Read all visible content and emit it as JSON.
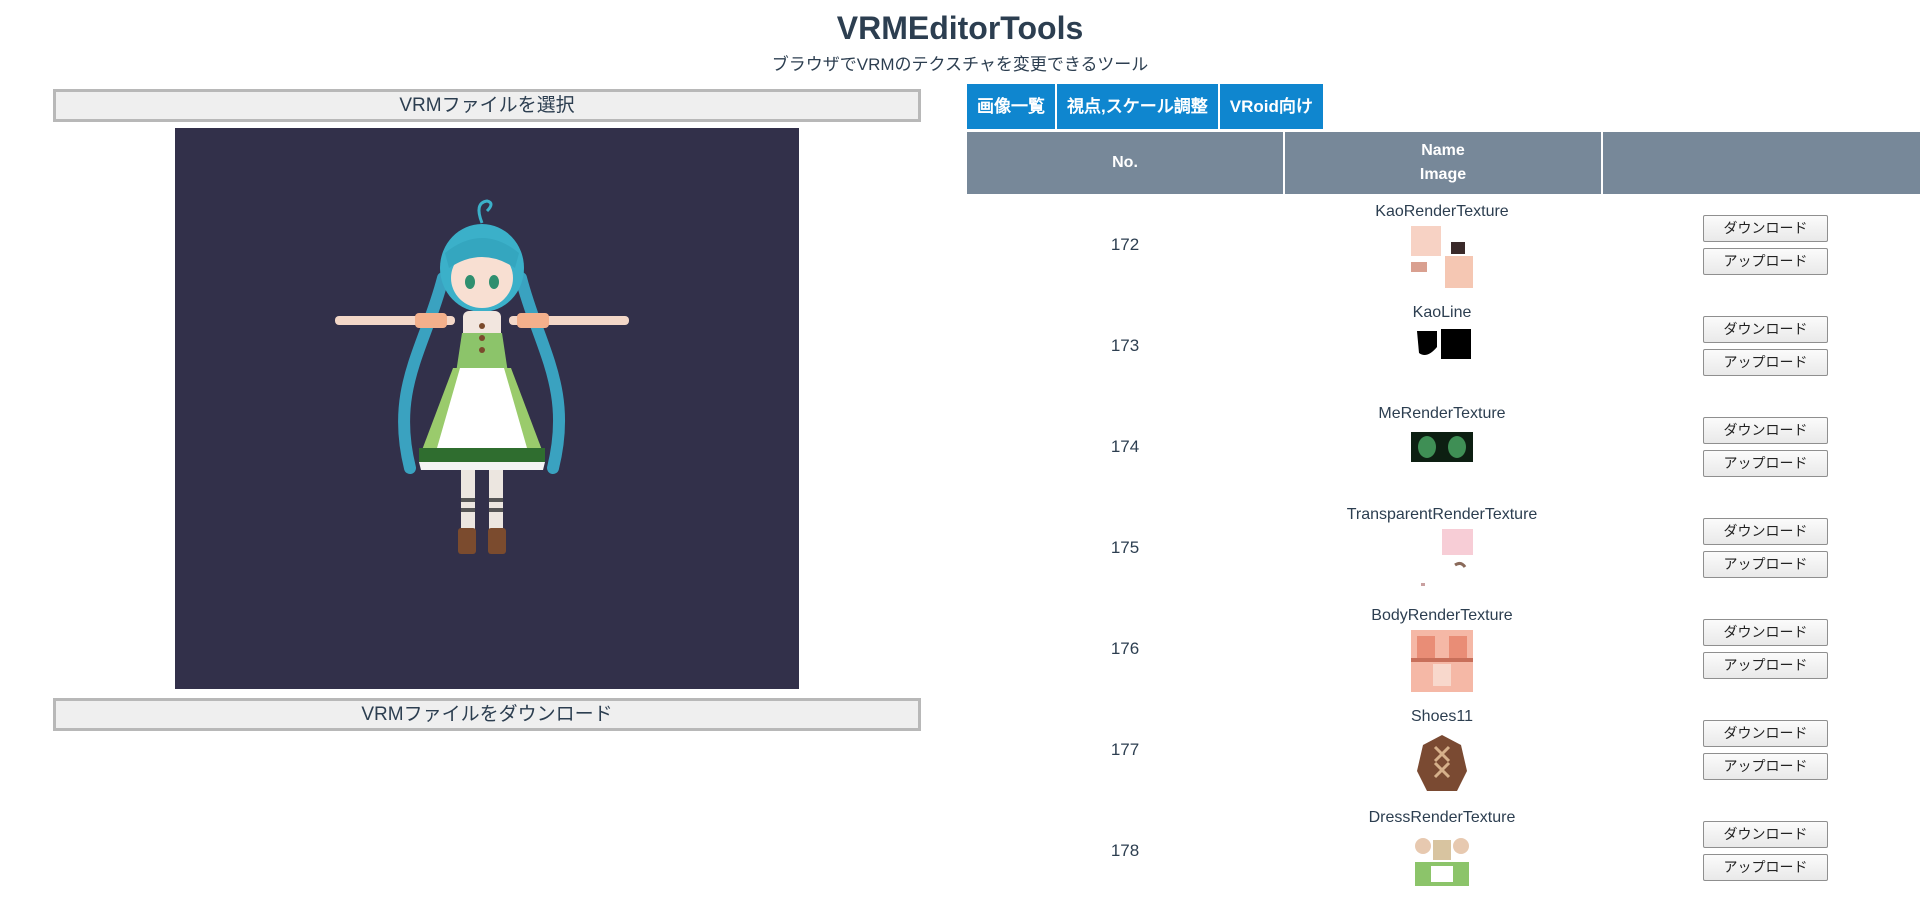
{
  "header": {
    "title": "VRMEditorTools",
    "subtitle": "ブラウザでVRMのテクスチャを変更できるツール"
  },
  "left_panel": {
    "select_button": "VRMファイルを選択",
    "download_button": "VRMファイルをダウンロード",
    "viewer_background": "#32304a"
  },
  "tabs": [
    {
      "label": "画像一覧"
    },
    {
      "label": "視点,スケール調整"
    },
    {
      "label": "VRoid向け"
    }
  ],
  "table": {
    "headers": {
      "no": "No.",
      "name": "Name",
      "image": "Image"
    },
    "download_label": "ダウンロード",
    "upload_label": "アップロード",
    "rows": [
      {
        "no": "172",
        "name": "KaoRenderTexture"
      },
      {
        "no": "173",
        "name": "KaoLine"
      },
      {
        "no": "174",
        "name": "MeRenderTexture"
      },
      {
        "no": "175",
        "name": "TransparentRenderTexture"
      },
      {
        "no": "176",
        "name": "BodyRenderTexture"
      },
      {
        "no": "177",
        "name": "Shoes11"
      },
      {
        "no": "178",
        "name": "DressRenderTexture"
      }
    ]
  },
  "colors": {
    "accent": "#0f86cf",
    "table_header": "#778899",
    "text": "#2c3e50"
  }
}
